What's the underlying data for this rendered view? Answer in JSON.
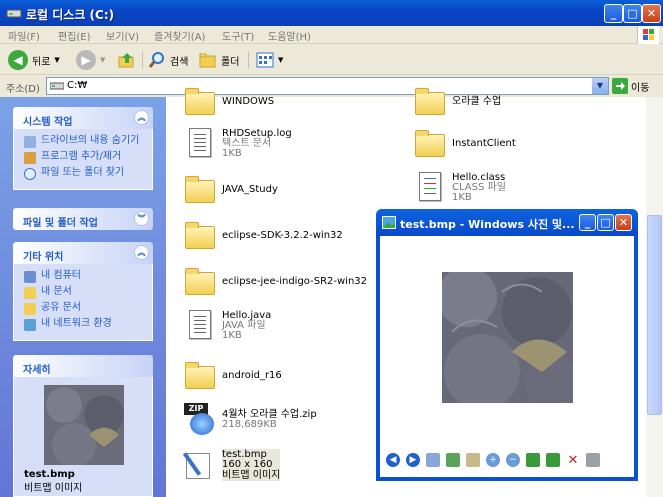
{
  "window": {
    "title": "로컬 디스크 (C:)"
  },
  "title_buttons": {
    "minimize": "_",
    "maximize": "□",
    "close": "✕"
  },
  "menu": [
    "파일(F)",
    "편집(E)",
    "보기(V)",
    "즐겨찾기(A)",
    "도구(T)",
    "도움말(H)"
  ],
  "toolbar": {
    "back_label": "뒤로",
    "search_label": "검색",
    "folders_label": "폴더"
  },
  "address": {
    "label": "주소(D)",
    "value": "C:₩",
    "go_label": "이동"
  },
  "sidebar": {
    "system_tasks": {
      "title": "시스템 작업",
      "items": [
        "드라이브의 내용 숨기기",
        "프로그램 추가/제거",
        "파일 또는 폴더 찾기"
      ]
    },
    "file_tasks": {
      "title": "파일 및 폴더 작업"
    },
    "other_places": {
      "title": "기타 위치",
      "items": [
        "내 컴퓨터",
        "내 문서",
        "공유 문서",
        "내 네트워크 환경"
      ]
    },
    "details": {
      "title": "자세히",
      "name": "test.bmp",
      "type": "비트맵 이미지"
    }
  },
  "files": [
    {
      "name": "WINDOWS",
      "sub1": "",
      "sub2": ""
    },
    {
      "name": "오라클 수업",
      "sub1": "",
      "sub2": ""
    },
    {
      "name": "RHDSetup.log",
      "sub1": "텍스트 문서",
      "sub2": "1KB"
    },
    {
      "name": "InstantClient",
      "sub1": "",
      "sub2": ""
    },
    {
      "name": "JAVA_Study",
      "sub1": "",
      "sub2": ""
    },
    {
      "name": "Hello.class",
      "sub1": "CLASS 파일",
      "sub2": "1KB"
    },
    {
      "name": "eclipse-SDK-3.2.2-win32",
      "sub1": "",
      "sub2": ""
    },
    {
      "name": "eclipse-jee-indigo-SR2-win32",
      "sub1": "",
      "sub2": ""
    },
    {
      "name": "Hello.java",
      "sub1": "JAVA 파일",
      "sub2": "1KB"
    },
    {
      "name": "android_r16",
      "sub1": "",
      "sub2": ""
    },
    {
      "name": "4월차 오라클 수업.zip",
      "sub1": "218,689KB",
      "sub2": ""
    },
    {
      "name": "test.bmp",
      "sub1": "160 x 160",
      "sub2": "비트맵 이미지"
    }
  ],
  "zip_badge": "ZIP",
  "viewer": {
    "title": "test.bmp - Windows 사진 및..."
  },
  "colors": {
    "title_blue": "#0a46c8",
    "task_link": "#215dc6",
    "folder_yellow": "#f2cf52",
    "close_red": "#c3411b"
  }
}
